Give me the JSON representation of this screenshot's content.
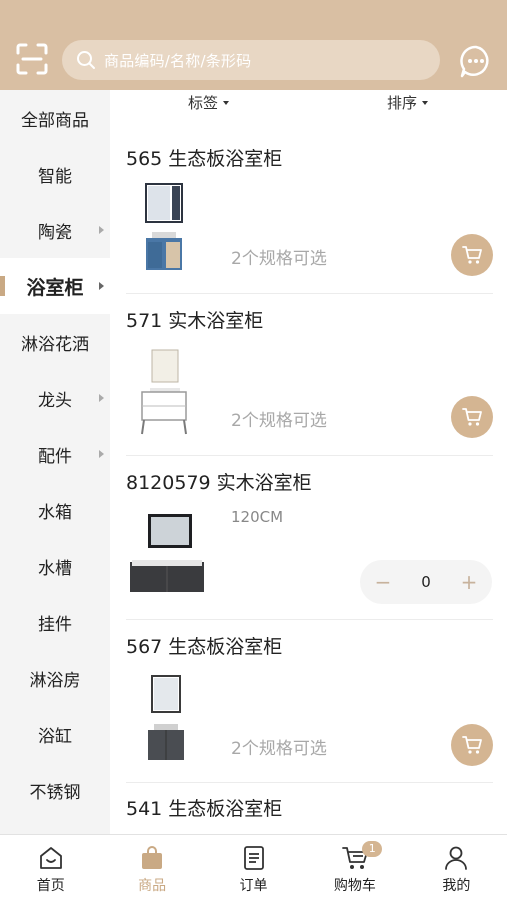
{
  "header": {
    "search_placeholder": "商品编码/名称/条形码",
    "accent_color": "#d9bfa3"
  },
  "sidebar": {
    "items": [
      {
        "label": "全部商品",
        "has_arrow": false,
        "active": false
      },
      {
        "label": "智能",
        "has_arrow": false,
        "active": false
      },
      {
        "label": "陶瓷",
        "has_arrow": true,
        "active": false
      },
      {
        "label": "浴室柜",
        "has_arrow": true,
        "active": true
      },
      {
        "label": "淋浴花洒",
        "has_arrow": false,
        "active": false
      },
      {
        "label": "龙头",
        "has_arrow": true,
        "active": false
      },
      {
        "label": "配件",
        "has_arrow": true,
        "active": false
      },
      {
        "label": "水箱",
        "has_arrow": false,
        "active": false
      },
      {
        "label": "水槽",
        "has_arrow": false,
        "active": false
      },
      {
        "label": "挂件",
        "has_arrow": false,
        "active": false
      },
      {
        "label": "淋浴房",
        "has_arrow": false,
        "active": false
      },
      {
        "label": "浴缸",
        "has_arrow": false,
        "active": false
      },
      {
        "label": "不锈钢",
        "has_arrow": false,
        "active": false
      }
    ]
  },
  "filters": {
    "tag_label": "标签",
    "sort_label": "排序"
  },
  "products": [
    {
      "title": "565 生态板浴室柜",
      "specs": "2个规格可选"
    },
    {
      "title": "571 实木浴室柜",
      "specs": "2个规格可选"
    },
    {
      "title": "8120579 实木浴室柜",
      "size": "120CM",
      "quantity": "0",
      "minus": "−",
      "plus": "+"
    },
    {
      "title": "567 生态板浴室柜",
      "specs": "2个规格可选"
    },
    {
      "title": "541 生态板浴室柜"
    }
  ],
  "tabbar": {
    "home": "首页",
    "products": "商品",
    "orders": "订单",
    "cart": "购物车",
    "cart_badge": "1",
    "mine": "我的"
  }
}
